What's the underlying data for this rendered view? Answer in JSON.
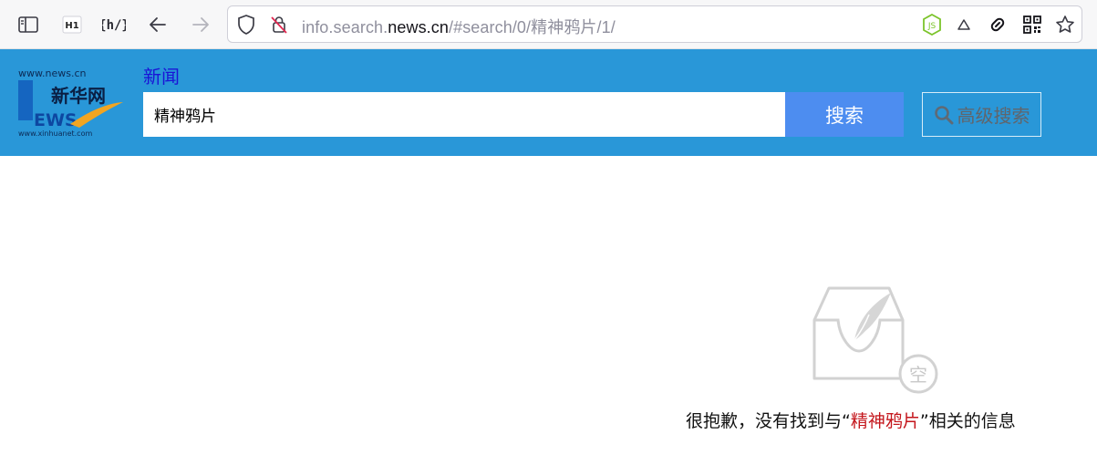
{
  "browser": {
    "url_host_prefix": "info.search.",
    "url_host": "news.cn",
    "url_path": "/#search/0/精神鸦片/1/",
    "icons": [
      "sidebar-icon",
      "h1-icon",
      "hv-icon",
      "back-arrow-icon",
      "forward-arrow-icon",
      "shield-icon",
      "tracking-blocked-icon",
      "nodejs-icon",
      "triangle-icon",
      "link-icon",
      "qr-code-icon",
      "star-icon"
    ]
  },
  "header": {
    "logo_text_top": "www.news.cn",
    "logo_text_cn": "新华网",
    "logo_text_news": "EWS",
    "logo_text_bottom": "www.xinhuanet.com",
    "nav_label": "新闻",
    "search_value": "精神鸦片",
    "search_button": "搜索",
    "advanced_search": "高级搜索",
    "colors": {
      "header_bg": "#2997d8",
      "search_btn": "#4d8df0",
      "nav_link": "#1a14d6"
    }
  },
  "empty_state": {
    "icon_char": "空",
    "message_prefix": "很抱歉，没有找到与",
    "quote_open": "“",
    "keyword": "精神鸦片",
    "quote_close": "”",
    "message_suffix": "相关的信息",
    "keyword_color": "#c4161c"
  }
}
